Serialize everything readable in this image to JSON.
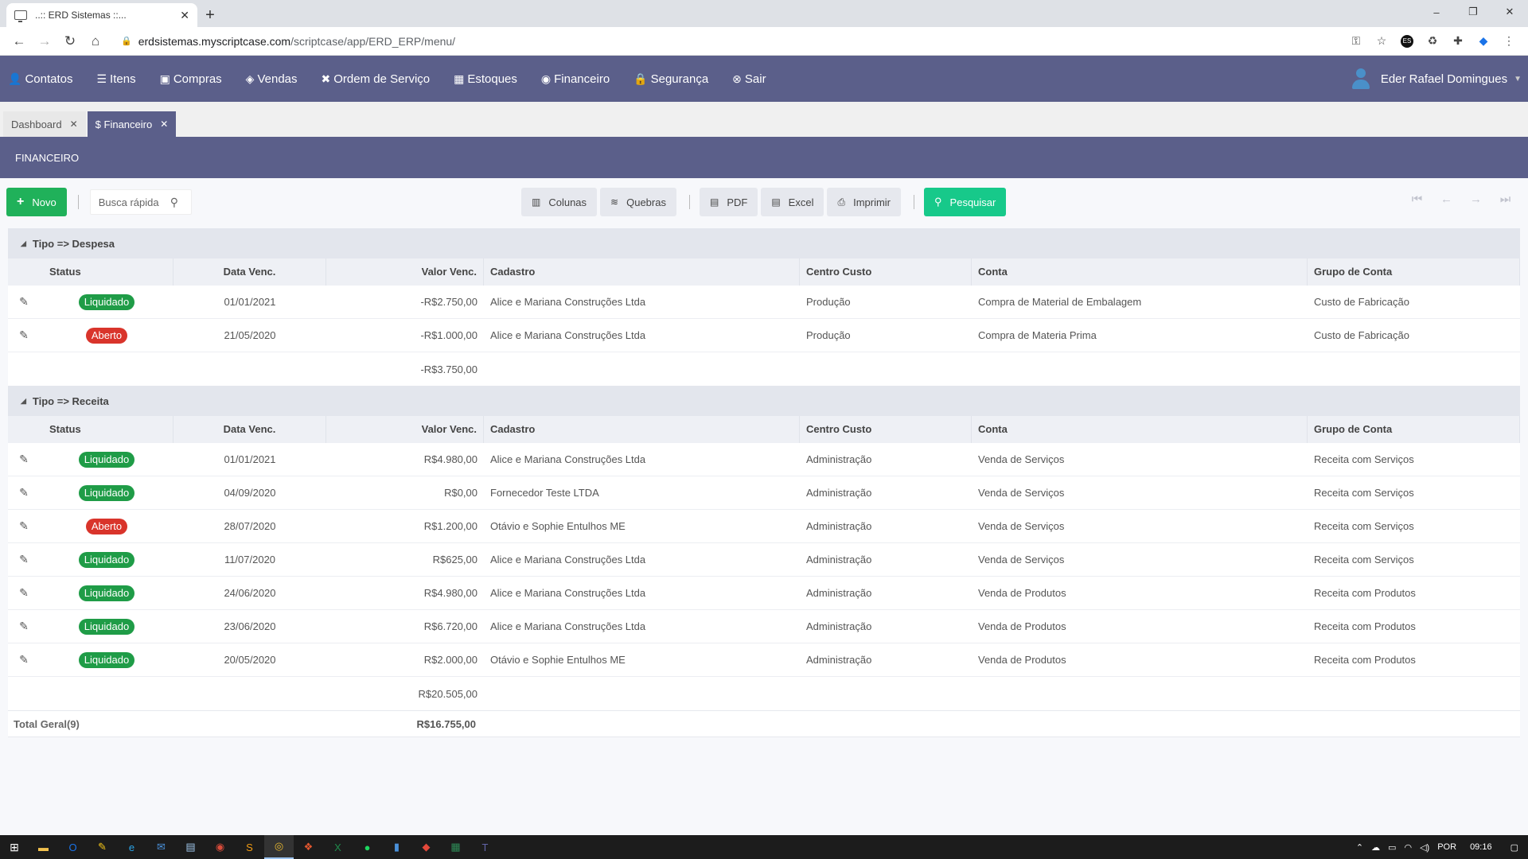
{
  "browser": {
    "tab_title": "..:: ERD Sistemas ::...",
    "url_host": "erdsistemas.myscriptcase.com",
    "url_path": "/scriptcase/app/ERD_ERP/menu/",
    "window_controls": [
      "–",
      "❐",
      "✕"
    ]
  },
  "nav": {
    "items": [
      {
        "label": "Contatos",
        "icon": "user-icon"
      },
      {
        "label": "Itens",
        "icon": "items-icon"
      },
      {
        "label": "Compras",
        "icon": "bag-icon"
      },
      {
        "label": "Vendas",
        "icon": "tags-icon"
      },
      {
        "label": "Ordem de Serviço",
        "icon": "tools-icon"
      },
      {
        "label": "Estoques",
        "icon": "cubes-icon"
      },
      {
        "label": "Financeiro",
        "icon": "coins-icon"
      },
      {
        "label": "Segurança",
        "icon": "lock-icon"
      },
      {
        "label": "Sair",
        "icon": "close-circle-icon"
      }
    ],
    "user_name": "Eder Rafael Domingues"
  },
  "app_tabs": [
    {
      "label": "Dashboard",
      "active": false
    },
    {
      "label": "$ Financeiro",
      "active": true
    }
  ],
  "section_title": "FINANCEIRO",
  "toolbar": {
    "new_label": "Novo",
    "search_placeholder": "Busca rápida",
    "columns_label": "Colunas",
    "breaks_label": "Quebras",
    "pdf_label": "PDF",
    "excel_label": "Excel",
    "print_label": "Imprimir",
    "search_label": "Pesquisar"
  },
  "columns": [
    "Status",
    "Data Venc.",
    "Valor Venc.",
    "Cadastro",
    "Centro Custo",
    "Conta",
    "Grupo de Conta"
  ],
  "groups": [
    {
      "title": "Tipo => Despesa",
      "rows": [
        {
          "status": "Liquidado",
          "status_color": "#1f9c47",
          "date": "01/01/2021",
          "value": "-R$2.750,00",
          "cadastro": "Alice e Mariana Construções Ltda",
          "centro": "Produção",
          "conta": "Compra de Material de Embalagem",
          "grupo": "Custo de Fabricação"
        },
        {
          "status": "Aberto",
          "status_color": "#d9342b",
          "date": "21/05/2020",
          "value": "-R$1.000,00",
          "cadastro": "Alice e Mariana Construções Ltda",
          "centro": "Produção",
          "conta": "Compra de Materia Prima",
          "grupo": "Custo de Fabricação"
        }
      ],
      "subtotal": "-R$3.750,00"
    },
    {
      "title": "Tipo => Receita",
      "rows": [
        {
          "status": "Liquidado",
          "status_color": "#1f9c47",
          "date": "01/01/2021",
          "value": "R$4.980,00",
          "cadastro": "Alice e Mariana Construções Ltda",
          "centro": "Administração",
          "conta": "Venda de Serviços",
          "grupo": "Receita com Serviços"
        },
        {
          "status": "Liquidado",
          "status_color": "#1f9c47",
          "date": "04/09/2020",
          "value": "R$0,00",
          "cadastro": "Fornecedor Teste LTDA",
          "centro": "Administração",
          "conta": "Venda de Serviços",
          "grupo": "Receita com Serviços"
        },
        {
          "status": "Aberto",
          "status_color": "#d9342b",
          "date": "28/07/2020",
          "value": "R$1.200,00",
          "cadastro": "Otávio e Sophie Entulhos ME",
          "centro": "Administração",
          "conta": "Venda de Serviços",
          "grupo": "Receita com Serviços"
        },
        {
          "status": "Liquidado",
          "status_color": "#1f9c47",
          "date": "11/07/2020",
          "value": "R$625,00",
          "cadastro": "Alice e Mariana Construções Ltda",
          "centro": "Administração",
          "conta": "Venda de Serviços",
          "grupo": "Receita com Serviços"
        },
        {
          "status": "Liquidado",
          "status_color": "#1f9c47",
          "date": "24/06/2020",
          "value": "R$4.980,00",
          "cadastro": "Alice e Mariana Construções Ltda",
          "centro": "Administração",
          "conta": "Venda de Produtos",
          "grupo": "Receita com Produtos"
        },
        {
          "status": "Liquidado",
          "status_color": "#1f9c47",
          "date": "23/06/2020",
          "value": "R$6.720,00",
          "cadastro": "Alice e Mariana Construções Ltda",
          "centro": "Administração",
          "conta": "Venda de Produtos",
          "grupo": "Receita com Produtos"
        },
        {
          "status": "Liquidado",
          "status_color": "#1f9c47",
          "date": "20/05/2020",
          "value": "R$2.000,00",
          "cadastro": "Otávio e Sophie Entulhos ME",
          "centro": "Administração",
          "conta": "Venda de Produtos",
          "grupo": "Receita com Produtos"
        }
      ],
      "subtotal": "R$20.505,00"
    }
  ],
  "total": {
    "label": "Total Geral(9)",
    "value": "R$16.755,00"
  },
  "taskbar": {
    "lang": "POR",
    "time": "09:16",
    "apps": [
      {
        "icon": "file-explorer-icon",
        "color": "#f2c14e",
        "glyph": "▬"
      },
      {
        "icon": "outlook-icon",
        "color": "#1a73e8",
        "glyph": "O"
      },
      {
        "icon": "sticky-notes-icon",
        "color": "#f5c518",
        "glyph": "✎"
      },
      {
        "icon": "edge-icon",
        "color": "#2aa4e8",
        "glyph": "e"
      },
      {
        "icon": "mail-icon",
        "color": "#4a90d9",
        "glyph": "✉"
      },
      {
        "icon": "notepad-icon",
        "color": "#9ec5e8",
        "glyph": "▤"
      },
      {
        "icon": "remote-desktop-icon",
        "color": "#d84b3a",
        "glyph": "◉"
      },
      {
        "icon": "sublime-icon",
        "color": "#f39c12",
        "glyph": "S"
      },
      {
        "icon": "chrome-icon",
        "color": "#e8b830",
        "glyph": "◎"
      },
      {
        "icon": "git-icon",
        "color": "#e3572f",
        "glyph": "❖"
      },
      {
        "icon": "excel-icon",
        "color": "#1f8a4c",
        "glyph": "X"
      },
      {
        "icon": "spotify-icon",
        "color": "#1ed760",
        "glyph": "●"
      },
      {
        "icon": "file-icon",
        "color": "#4a90d9",
        "glyph": "▮"
      },
      {
        "icon": "brave-icon",
        "color": "#e4483a",
        "glyph": "◆"
      },
      {
        "icon": "spreadsheet-icon",
        "color": "#2e8b57",
        "glyph": "▦"
      },
      {
        "icon": "teams-icon",
        "color": "#6264a7",
        "glyph": "T"
      }
    ]
  }
}
